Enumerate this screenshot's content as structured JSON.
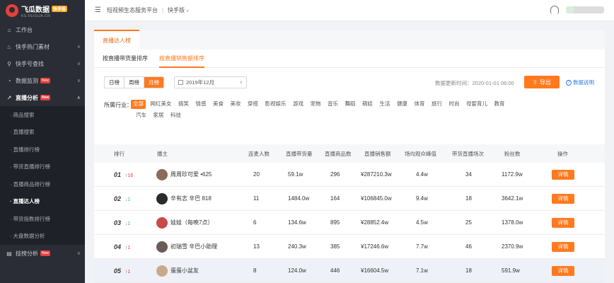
{
  "brand": {
    "title": "飞瓜数据",
    "badge": "快手版",
    "domain": "KS.FEIGUA.CN"
  },
  "sidebar": {
    "items": [
      {
        "label": "工作台",
        "icon": "home-icon",
        "chevron": false
      },
      {
        "label": "快手热门素材",
        "icon": "fire-icon",
        "chevron": true
      },
      {
        "label": "快手号查找",
        "icon": "search-icon",
        "chevron": true
      },
      {
        "label": "数据监测",
        "icon": "monitor-icon",
        "chevron": true,
        "new": "New"
      },
      {
        "label": "直播分析",
        "icon": "trend-icon",
        "chevron": true,
        "new": "New",
        "open": true
      }
    ],
    "sub_items": [
      "商品搜索",
      "直播搜索",
      "直播排行榜",
      "带货直播排行榜",
      "直播商品排行榜",
      "直播达人榜",
      "带货指数排行榜",
      "大盘数据分析"
    ],
    "active_sub": 5,
    "bottom_item": {
      "label": "技榜分析",
      "icon": "chart-icon",
      "new": "New"
    }
  },
  "topbar": {
    "platform": "短视频生态服务平台",
    "version": "快手版"
  },
  "main_tab": "直播达人榜",
  "sub_tabs": [
    "按直播带货量排序",
    "按直播销售额排序"
  ],
  "active_sub_tab": 1,
  "period": {
    "options": [
      "日榜",
      "周榜",
      "月榜"
    ],
    "active": 2
  },
  "month": "2019年12月",
  "update_time": "数据更新时间：2020-01-01 06:00",
  "export_label": "导出",
  "explain_label": "数据说明",
  "industry": {
    "label": "所属行业：",
    "row1": [
      "全部",
      "网红美女",
      "搞笑",
      "情感",
      "美食",
      "美妆",
      "穿搭",
      "影视娱乐",
      "游戏",
      "宠物",
      "音乐",
      "舞蹈",
      "萌娃",
      "生活",
      "健康",
      "体育",
      "旅行",
      "时尚",
      "母婴育儿",
      "教育"
    ],
    "row2": [
      "汽车",
      "家居",
      "科技"
    ]
  },
  "table": {
    "headers": [
      "排行",
      "播主",
      "连麦人数",
      "直播带货量",
      "直播商品数",
      "直播销售额",
      "场均观众峰值",
      "带货直播场次",
      "粉丝数",
      "操作"
    ],
    "rows": [
      {
        "rank": "01",
        "trend": "↑16",
        "dir": "up",
        "name": "周周珍可爱 •625",
        "lianmai": "20",
        "volume": "59.1w",
        "goods": "296",
        "sales": "¥287210.3w",
        "peak": "4.4w",
        "sessions": "34",
        "fans": "1172.9w",
        "action": "详情",
        "avatar": "#8a6a5a"
      },
      {
        "rank": "02",
        "trend": "↓1",
        "dir": "down",
        "name": "辛有志 辛巴 818",
        "lianmai": "11",
        "volume": "1484.0w",
        "goods": "164",
        "sales": "¥106845.0w",
        "peak": "9.4w",
        "sessions": "18",
        "fans": "3642.1w",
        "action": "详情",
        "avatar": "#2b2b2b"
      },
      {
        "rank": "03",
        "trend": "↓1",
        "dir": "down",
        "name": "娃娃（每晚7点）",
        "lianmai": "6",
        "volume": "134.6w",
        "goods": "895",
        "sales": "¥28852.4w",
        "peak": "4.5w",
        "sessions": "25",
        "fans": "1378.0w",
        "action": "详情",
        "avatar": "#c84a4a"
      },
      {
        "rank": "04",
        "trend": "↑1",
        "dir": "up",
        "name": "初瑞雪 辛巴小助理",
        "lianmai": "13",
        "volume": "240.3w",
        "goods": "385",
        "sales": "¥17246.6w",
        "peak": "7.7w",
        "sessions": "46",
        "fans": "2370.9w",
        "action": "详情",
        "avatar": "#6b5a55"
      },
      {
        "rank": "05",
        "trend": "↑1",
        "dir": "up",
        "name": "蛋蛋小盆友",
        "lianmai": "8",
        "volume": "124.0w",
        "goods": "446",
        "sales": "¥16604.5w",
        "peak": "7.1w",
        "sessions": "18",
        "fans": "591.9w",
        "action": "详情",
        "avatar": "#c9a98a"
      }
    ]
  },
  "colors": {
    "accent": "#ff7a1f",
    "sidebar": "#2a2d35",
    "up": "#e5403a",
    "down": "#3dbb6b",
    "link": "#2f7ae5"
  }
}
